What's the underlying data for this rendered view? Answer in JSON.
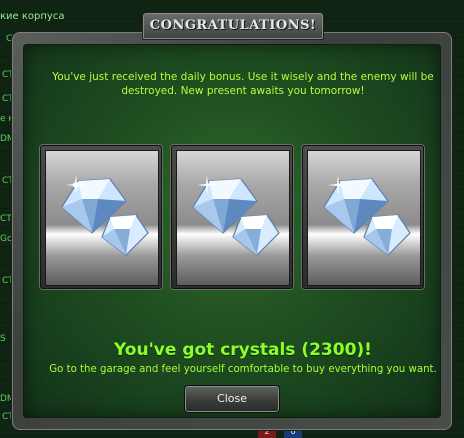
{
  "background": {
    "rows": [
      {
        "text": "кие корпуса",
        "top": true
      },
      {
        "text": "CTF"
      },
      {
        "text": "CTF"
      },
      {
        "text": "CTF"
      },
      {
        "text": "е ки"
      },
      {
        "text": "DM"
      },
      {
        "text": "CTF"
      },
      {
        "text": "CTF"
      },
      {
        "text": "Gol"
      },
      {
        "text": "CTF"
      },
      {
        "text": "S"
      },
      {
        "text": "DM"
      },
      {
        "text": "CTF"
      }
    ],
    "scores": [
      "2",
      "0"
    ]
  },
  "dialog": {
    "title": "CONGRATULATIONS!",
    "message": "You've just received the daily bonus. Use it wisely and the enemy will be destroyed. New present awaits you tomorrow!",
    "slots": [
      {
        "icon": "crystal-icon"
      },
      {
        "icon": "crystal-icon"
      },
      {
        "icon": "crystal-icon"
      }
    ],
    "reward_text": "You've got crystals (2300)!",
    "hint_text": "Go to the garage and feel yourself comfortable to buy everything you want.",
    "close_label": "Close"
  },
  "colors": {
    "accent_text": "#b7ff3c",
    "reward_text": "#8cff2a",
    "panel_green": "#1f4e20"
  }
}
